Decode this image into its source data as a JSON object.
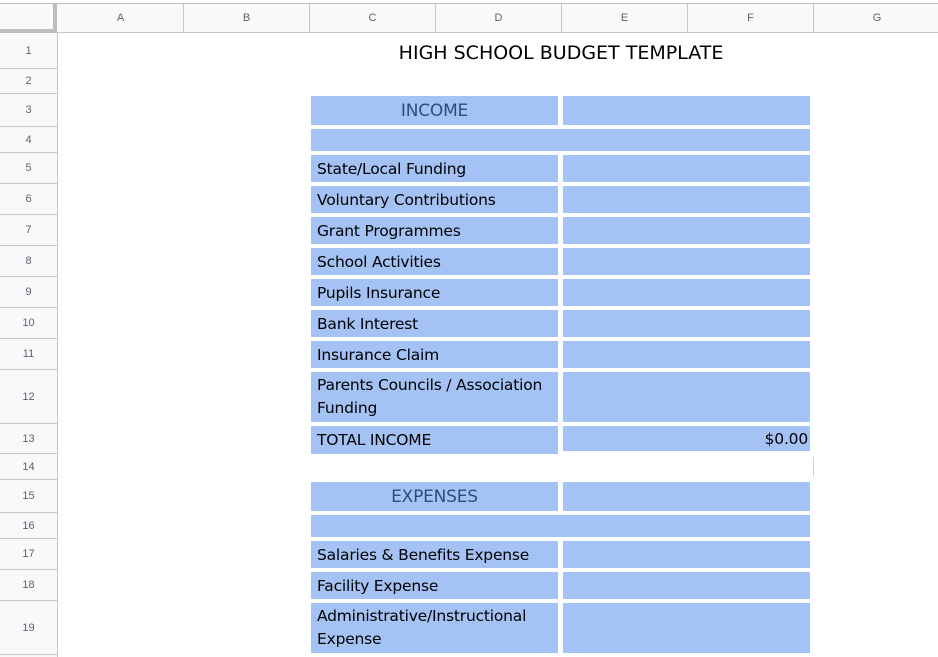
{
  "columns": [
    "A",
    "B",
    "C",
    "D",
    "E",
    "F",
    "G"
  ],
  "rows": [
    "1",
    "2",
    "3",
    "4",
    "5",
    "6",
    "7",
    "8",
    "9",
    "10",
    "11",
    "12",
    "13",
    "14",
    "15",
    "16",
    "17",
    "18",
    "19"
  ],
  "sheet": {
    "title": "HIGH SCHOOL BUDGET TEMPLATE",
    "fill_color": "#a4c2f4",
    "section_text_color": "#284e80",
    "income": {
      "header": "INCOME",
      "items": [
        {
          "label": "State/Local Funding",
          "value": ""
        },
        {
          "label": "Voluntary Contributions",
          "value": ""
        },
        {
          "label": "Grant Programmes",
          "value": ""
        },
        {
          "label": "School Activities",
          "value": ""
        },
        {
          "label": "Pupils Insurance",
          "value": ""
        },
        {
          "label": "Bank Interest",
          "value": ""
        },
        {
          "label": "Insurance Claim",
          "value": ""
        },
        {
          "label": "Parents Councils / Association Funding",
          "value": ""
        }
      ],
      "total_label": "TOTAL INCOME",
      "total_value": "$0.00"
    },
    "expenses": {
      "header": "EXPENSES",
      "items": [
        {
          "label": "Salaries & Benefits Expense",
          "value": ""
        },
        {
          "label": "Facility Expense",
          "value": ""
        },
        {
          "label": "Administrative/Instructional Expense",
          "value": ""
        }
      ]
    }
  }
}
